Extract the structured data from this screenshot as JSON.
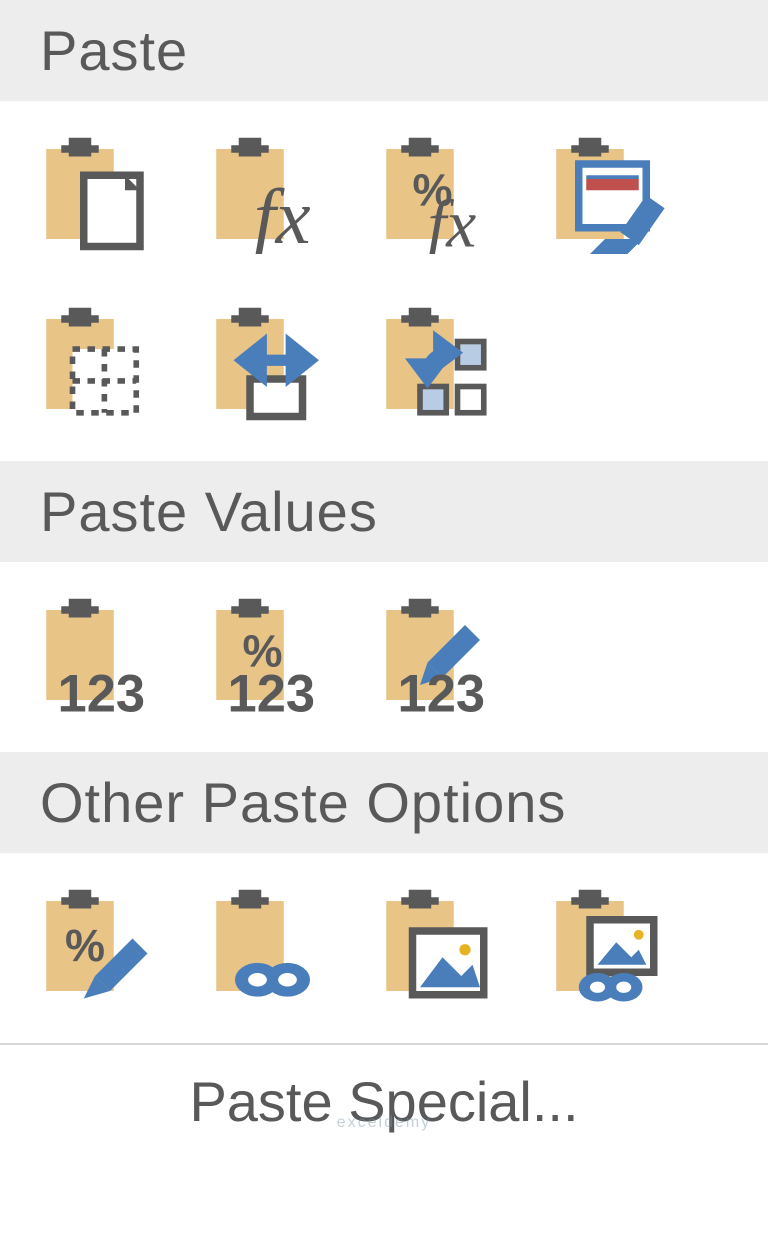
{
  "sections": {
    "paste_header": "Paste",
    "paste_values_header": "Paste Values",
    "other_header": "Other Paste Options"
  },
  "footer": {
    "paste_special": "Paste Special..."
  },
  "icons": {
    "paste": "paste",
    "formulas": "formulas",
    "formulas_number_formatting": "formulas-number-formatting",
    "keep_source_formatting": "keep-source-formatting",
    "no_borders": "no-borders",
    "keep_column_widths": "keep-source-column-widths",
    "transpose": "transpose",
    "values": "values",
    "values_number_formatting": "values-number-formatting",
    "values_source_formatting": "values-source-formatting",
    "formatting": "formatting",
    "paste_link": "paste-link",
    "picture": "picture",
    "linked_picture": "linked-picture"
  },
  "watermark": "exceldemy"
}
